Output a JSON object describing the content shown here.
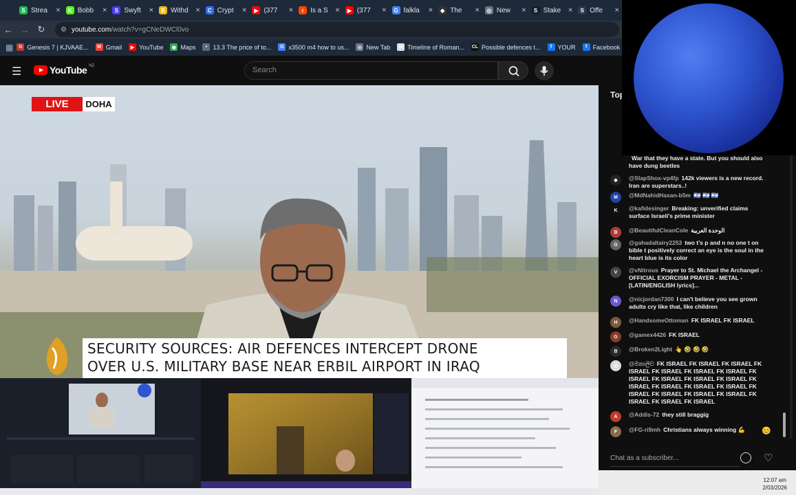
{
  "browser": {
    "tabs": [
      {
        "label": "Strea",
        "icon": "stream-icon",
        "color": "#1db954",
        "glyph": "S"
      },
      {
        "label": "Bobb",
        "icon": "kick-icon",
        "color": "#53fc18",
        "glyph": "K"
      },
      {
        "label": "Swyft",
        "icon": "swyftx-icon",
        "color": "#4b3cff",
        "glyph": "S"
      },
      {
        "label": "Withd",
        "icon": "binance-icon",
        "color": "#f0b90b",
        "glyph": "B"
      },
      {
        "label": "Crypt",
        "icon": "crypto-icon",
        "color": "#2f6fed",
        "glyph": "C"
      },
      {
        "label": "(377",
        "icon": "youtube-icon",
        "color": "#ff0000",
        "glyph": "▶"
      },
      {
        "label": "Is a S",
        "icon": "reddit-icon",
        "color": "#ff4500",
        "glyph": "r"
      },
      {
        "label": "(377",
        "icon": "youtube-icon",
        "color": "#ff0000",
        "glyph": "▶"
      },
      {
        "label": "falkla",
        "icon": "google-icon",
        "color": "#4285f4",
        "glyph": "G"
      },
      {
        "label": "The",
        "icon": "github-icon",
        "color": "#333333",
        "glyph": "◆"
      },
      {
        "label": "New",
        "icon": "newtab-icon",
        "color": "#6b7480",
        "glyph": "◎"
      },
      {
        "label": "Stake",
        "icon": "stake-icon",
        "color": "#0f212e",
        "glyph": "S"
      },
      {
        "label": "Offe",
        "icon": "stake-offer-icon",
        "color": "#2b3b4a",
        "glyph": "S"
      }
    ],
    "url_host": "youtube.com",
    "url_path": "/watch?v=gCNeDWCl0vo",
    "bookmarks": [
      {
        "label": "Genesis 7 | KJVAAE...",
        "icon": "bible-icon",
        "color": "#c0392b",
        "glyph": "G"
      },
      {
        "label": "Gmail",
        "icon": "gmail-icon",
        "color": "#ea4335",
        "glyph": "M"
      },
      {
        "label": "YouTube",
        "icon": "youtube-icon",
        "color": "#ff0000",
        "glyph": "▶"
      },
      {
        "label": "Maps",
        "icon": "maps-icon",
        "color": "#34a853",
        "glyph": "◉"
      },
      {
        "label": "13.3 The price of to...",
        "icon": "page-icon",
        "color": "#5f6b78",
        "glyph": "•"
      },
      {
        "label": "x3500 m4 how to us...",
        "icon": "google-icon",
        "color": "#4285f4",
        "glyph": "G"
      },
      {
        "label": "New Tab",
        "icon": "newtab-icon",
        "color": "#6b7480",
        "glyph": "◎"
      },
      {
        "label": "Timeline of Roman...",
        "icon": "wikipedia-icon",
        "color": "#dddddd",
        "glyph": "W"
      },
      {
        "label": "Possible defences t...",
        "icon": "cl-icon",
        "color": "#111111",
        "glyph": "CL"
      },
      {
        "label": "YOUR",
        "icon": "facebook-icon",
        "color": "#1877f2",
        "glyph": "f"
      },
      {
        "label": "Facebook green",
        "icon": "facebook-icon",
        "color": "#1877f2",
        "glyph": "f"
      }
    ]
  },
  "youtube": {
    "logo_text": "YouTube",
    "country": "NZ",
    "search_placeholder": "Search"
  },
  "video": {
    "live_label": "LIVE",
    "location": "DOHA",
    "headline_line1": "SECURITY SOURCES: AIR DEFENCES INTERCEPT DRONE",
    "headline_line2": "OVER U.S. MILITARY BASE NEAR ERBIL AIRPORT IN IRAQ"
  },
  "chat": {
    "header": "Top",
    "messages": [
      {
        "author": "",
        "text": "War that they have a state. But you should also have dung beetles",
        "avatar_color": "#000000",
        "glyph": ""
      },
      {
        "author": "@SlapShox-vp4fp",
        "text": "142k viewers is a new record. Iran are superstars..!",
        "avatar_color": "#222222",
        "glyph": "◆"
      },
      {
        "author": "@MdNahidHasan-b5m",
        "text": "🇮🇱 🇮🇱 🇮🇱",
        "avatar_color": "#2244aa",
        "glyph": "M"
      },
      {
        "author": "@kafidesinger",
        "text": "Breaking: unverified claims surface Israeli's prime minister",
        "avatar_color": "#111111",
        "glyph": "K"
      },
      {
        "author": "@BeautifulCleanCole",
        "text": "الوحدة العربية",
        "avatar_color": "#b23a3a",
        "glyph": "B"
      },
      {
        "author": "@gahadaltairy2253",
        "text": "two t's p and n no one t on bible t positively correct an eye is the soul in the heart blue is its color",
        "avatar_color": "#666666",
        "glyph": "G"
      },
      {
        "author": "@vNitrous",
        "text": "Prayer to St. Michael the Archangel - OFFICIAL EXORCISM PRAYER - METAL - [LATIN/ENGLISH lyrics]...",
        "avatar_color": "#444444",
        "glyph": "V"
      },
      {
        "author": "@nicjordan7300",
        "text": "I can't believe you see grown adults cry like that, like children",
        "avatar_color": "#6a5acd",
        "glyph": "N"
      },
      {
        "author": "@HandsomeOttoman",
        "text": "FK ISRAEL FK ISRAEL",
        "avatar_color": "#7a5a3a",
        "glyph": "H"
      },
      {
        "author": "@gamex4426",
        "text": "FK ISRAEL",
        "avatar_color": "#8a3a2a",
        "glyph": "G"
      },
      {
        "author": "@Broken2Light",
        "text": "👆 🤣 🤣 🤣",
        "avatar_color": "#2a2a2a",
        "glyph": "B"
      },
      {
        "author": "@මනාලිව",
        "text": "FK ISRAEL FK ISRAEL FK ISRAEL FK ISRAEL FK ISRAEL FK ISRAEL FK ISRAEL FK ISRAEL FK ISRAEL FK ISRAEL FK ISRAEL FK ISRAEL FK ISRAEL FK ISRAEL FK ISRAEL FK ISRAEL FK ISRAEL FK ISRAEL FK ISRAEL FK ISRAEL FK ISRAEL FK ISRAEL",
        "avatar_color": "#dddddd",
        "glyph": "◎"
      },
      {
        "author": "@Addis-72",
        "text": "they still braggig",
        "avatar_color": "#c0392b",
        "glyph": "A"
      },
      {
        "author": "@FG-ri9mh",
        "text": "Christians always winning 💪",
        "avatar_color": "#8b6a4a",
        "glyph": "F"
      }
    ],
    "input_placeholder": "Chat as a subscriber...",
    "emoji_side": "😊"
  },
  "taskbar": {
    "time": "12:07 am",
    "date": "2/03/2026"
  },
  "colors": {
    "youtube_red": "#ff0000",
    "live_red": "#e01414",
    "planet_blue": "#2f56d0"
  }
}
